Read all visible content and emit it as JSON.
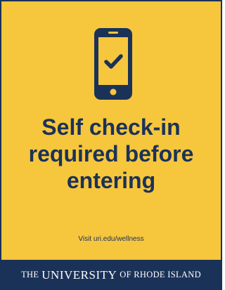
{
  "colors": {
    "background_yellow": "#f6c63d",
    "navy": "#1b3258",
    "footer_text": "#ffffff"
  },
  "icon": "smartphone-checkmark-icon",
  "headline": {
    "line1": "Self check-in",
    "line2": "required before",
    "line3": "entering"
  },
  "visit_text": "Visit uri.edu/wellness",
  "footer": {
    "prefix": "THE",
    "name": "UNIVERSITY",
    "suffix": "OF RHODE ISLAND"
  }
}
